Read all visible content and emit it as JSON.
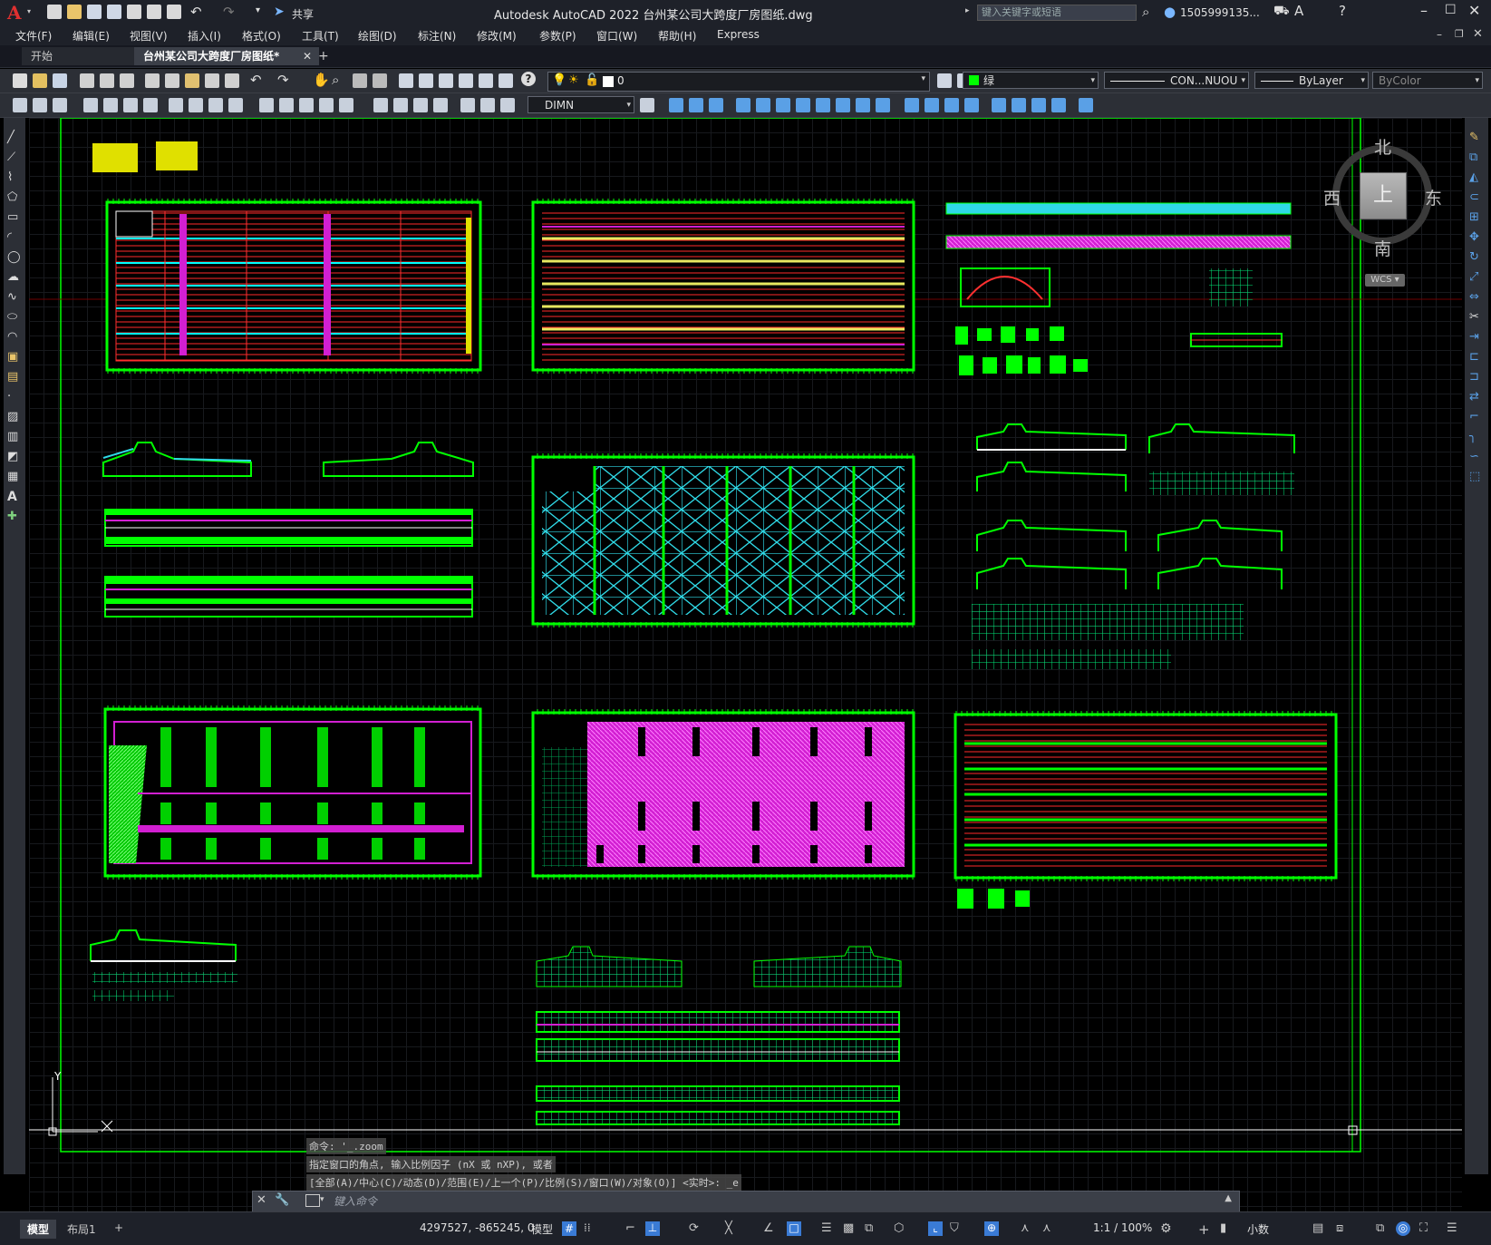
{
  "app": {
    "title": "Autodesk AutoCAD 2022    台州某公司大跨度厂房图纸.dwg",
    "share_label": "共享",
    "search_placeholder": "键入关键字或短语",
    "user": "1505999135...",
    "logo": "A"
  },
  "menu": [
    "文件(F)",
    "编辑(E)",
    "视图(V)",
    "插入(I)",
    "格式(O)",
    "工具(T)",
    "绘图(D)",
    "标注(N)",
    "修改(M)",
    "参数(P)",
    "窗口(W)",
    "帮助(H)",
    "Express"
  ],
  "tabs": {
    "start": "开始",
    "drawing": "台州某公司大跨度厂房图纸*",
    "add": "+"
  },
  "properties": {
    "layer": "0",
    "color": "绿",
    "linetype": "CON...NUOU",
    "lineweight": "ByLayer",
    "plotstyle": "ByColor",
    "dimstyle": "DIMN",
    "colors": {
      "layer_swatch": "#ffffff",
      "color_swatch": "#00ff00"
    }
  },
  "viewcube": {
    "north": "北",
    "south": "南",
    "east": "东",
    "west": "西",
    "top": "上",
    "wcs": "WCS"
  },
  "command": {
    "history": [
      "命令: '_.zoom",
      "指定窗口的角点, 输入比例因子 (nX 或 nXP), 或者",
      "[全部(A)/中心(C)/动态(D)/范围(E)/上一个(P)/比例(S)/窗口(W)/对象(O)] <实时>: _e"
    ],
    "placeholder": "键入命令"
  },
  "ucs": {
    "y": "Y"
  },
  "status": {
    "model_tab": "模型",
    "layout_tab": "布局1",
    "add": "+",
    "coords": "4297527, -865245, 0",
    "space": "模型",
    "scale": "1:1 / 100%",
    "units": "小数"
  }
}
